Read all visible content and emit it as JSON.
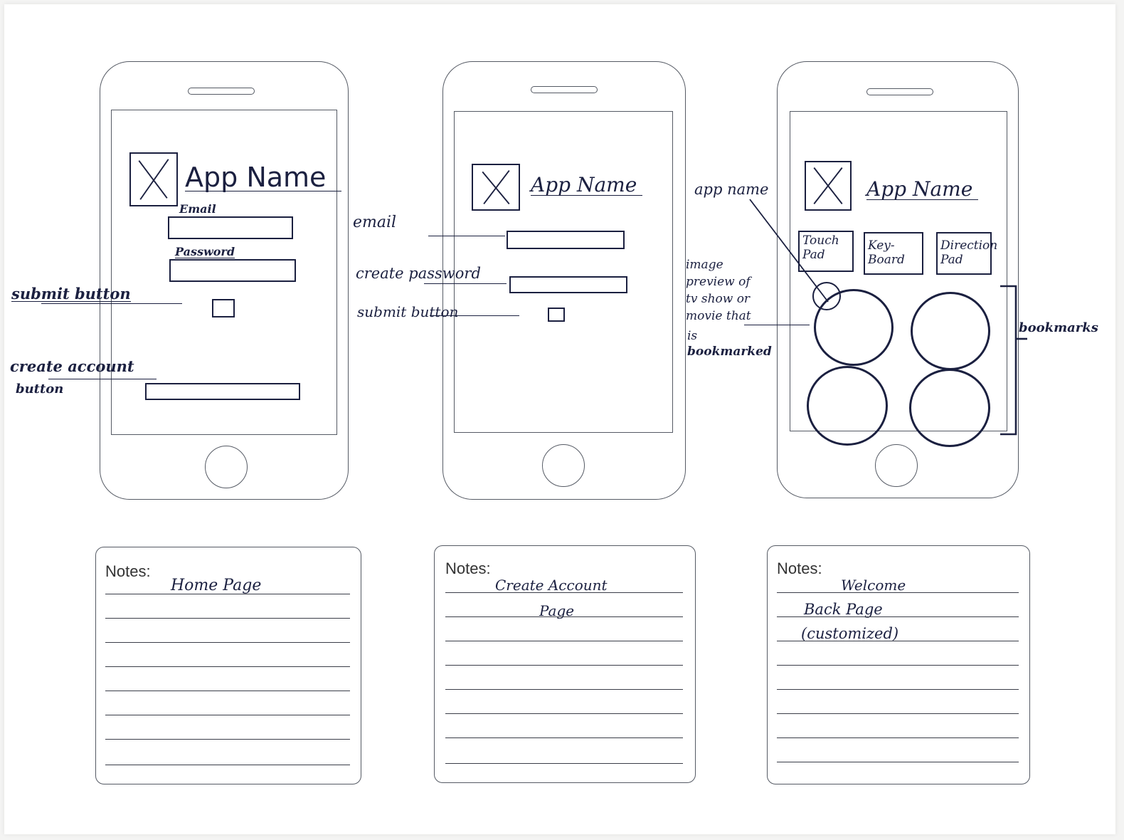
{
  "app_name": "App Name",
  "notes_label": "Notes:",
  "screen1": {
    "email_label": "Email",
    "password_label": "Password",
    "annot_submit": "submit button",
    "annot_create_1": "create account",
    "annot_create_2": "button",
    "notes": "Home Page"
  },
  "screen2": {
    "annot_email": "email",
    "annot_password": "create password",
    "annot_submit": "submit button",
    "notes_line1": "Create Account",
    "notes_line2": "Page"
  },
  "screen3": {
    "annot_app_name": "app name",
    "tab_touch": "Touch Pad",
    "tab_keyboard": "Key-Board",
    "tab_direction": "Direction Pad",
    "annot_preview_1": "image",
    "annot_preview_2": "preview of",
    "annot_preview_3": "tv show or",
    "annot_preview_4": "movie that",
    "annot_preview_5": "is",
    "annot_preview_6": "bookmarked",
    "annot_bookmarks": "bookmarks",
    "notes_line1": "Welcome",
    "notes_line2": "Back Page",
    "notes_line3": "(customized)"
  },
  "icons": {
    "placeholder": "image-placeholder-icon"
  },
  "colors": {
    "ink": "#1b2040",
    "outline": "#555a64",
    "paper": "#ffffff"
  }
}
